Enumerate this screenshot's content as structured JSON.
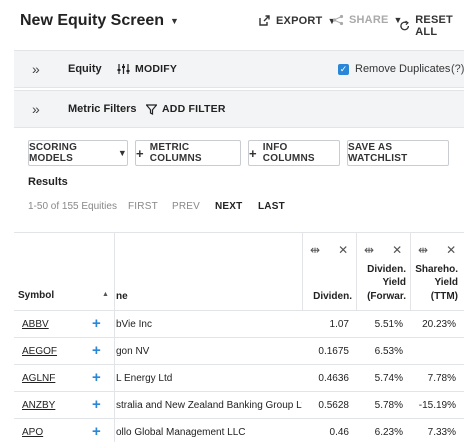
{
  "header": {
    "title": "New Equity Screen",
    "export_label": "EXPORT",
    "share_label": "SHARE",
    "reset_label": "RESET ALL"
  },
  "equity_bar": {
    "label": "Equity",
    "modify_label": "MODIFY",
    "remove_duplicates_label": "Remove Duplicates",
    "remove_duplicates_checked": true,
    "help_label": "(?)"
  },
  "metric_bar": {
    "label": "Metric Filters",
    "add_filter_label": "ADD FILTER"
  },
  "toolbar": {
    "scoring_models": "SCORING MODELS",
    "metric_columns": "METRIC COLUMNS",
    "info_columns": "INFO COLUMNS",
    "save_watchlist": "SAVE AS WATCHLIST"
  },
  "results": {
    "title": "Results",
    "range_text": "1-50 of 155 Equities",
    "first": "FIRST",
    "prev": "PREV",
    "next": "NEXT",
    "last": "LAST"
  },
  "table": {
    "symbol_header": "Symbol",
    "name_header_visible": "ne",
    "columns": [
      {
        "label_lines": [
          "Dividen."
        ]
      },
      {
        "label_lines": [
          "Dividen.",
          "Yield",
          "(Forwar."
        ]
      },
      {
        "label_lines": [
          "Shareho.",
          "Yield",
          "(TTM)"
        ]
      }
    ],
    "rows": [
      {
        "symbol": "ABBV",
        "name": "bVie Inc",
        "dividend": "1.07",
        "yield_fwd": "5.51%",
        "sh_yield": "20.23%"
      },
      {
        "symbol": "AEGOF",
        "name": "gon NV",
        "dividend": "0.1675",
        "yield_fwd": "6.53%",
        "sh_yield": ""
      },
      {
        "symbol": "AGLNF",
        "name": "L Energy Ltd",
        "dividend": "0.4636",
        "yield_fwd": "5.74%",
        "sh_yield": "7.78%"
      },
      {
        "symbol": "ANZBY",
        "name": "stralia and New Zealand Banking Group Ltd",
        "dividend": "0.5628",
        "yield_fwd": "5.78%",
        "sh_yield": "-15.19%"
      },
      {
        "symbol": "APO",
        "name": "ollo Global Management LLC",
        "dividend": "0.46",
        "yield_fwd": "6.23%",
        "sh_yield": "7.33%"
      }
    ]
  },
  "colors": {
    "accent": "#2a86d6",
    "bar_bg": "#f3f4f6",
    "border": "#e2e4e8"
  }
}
